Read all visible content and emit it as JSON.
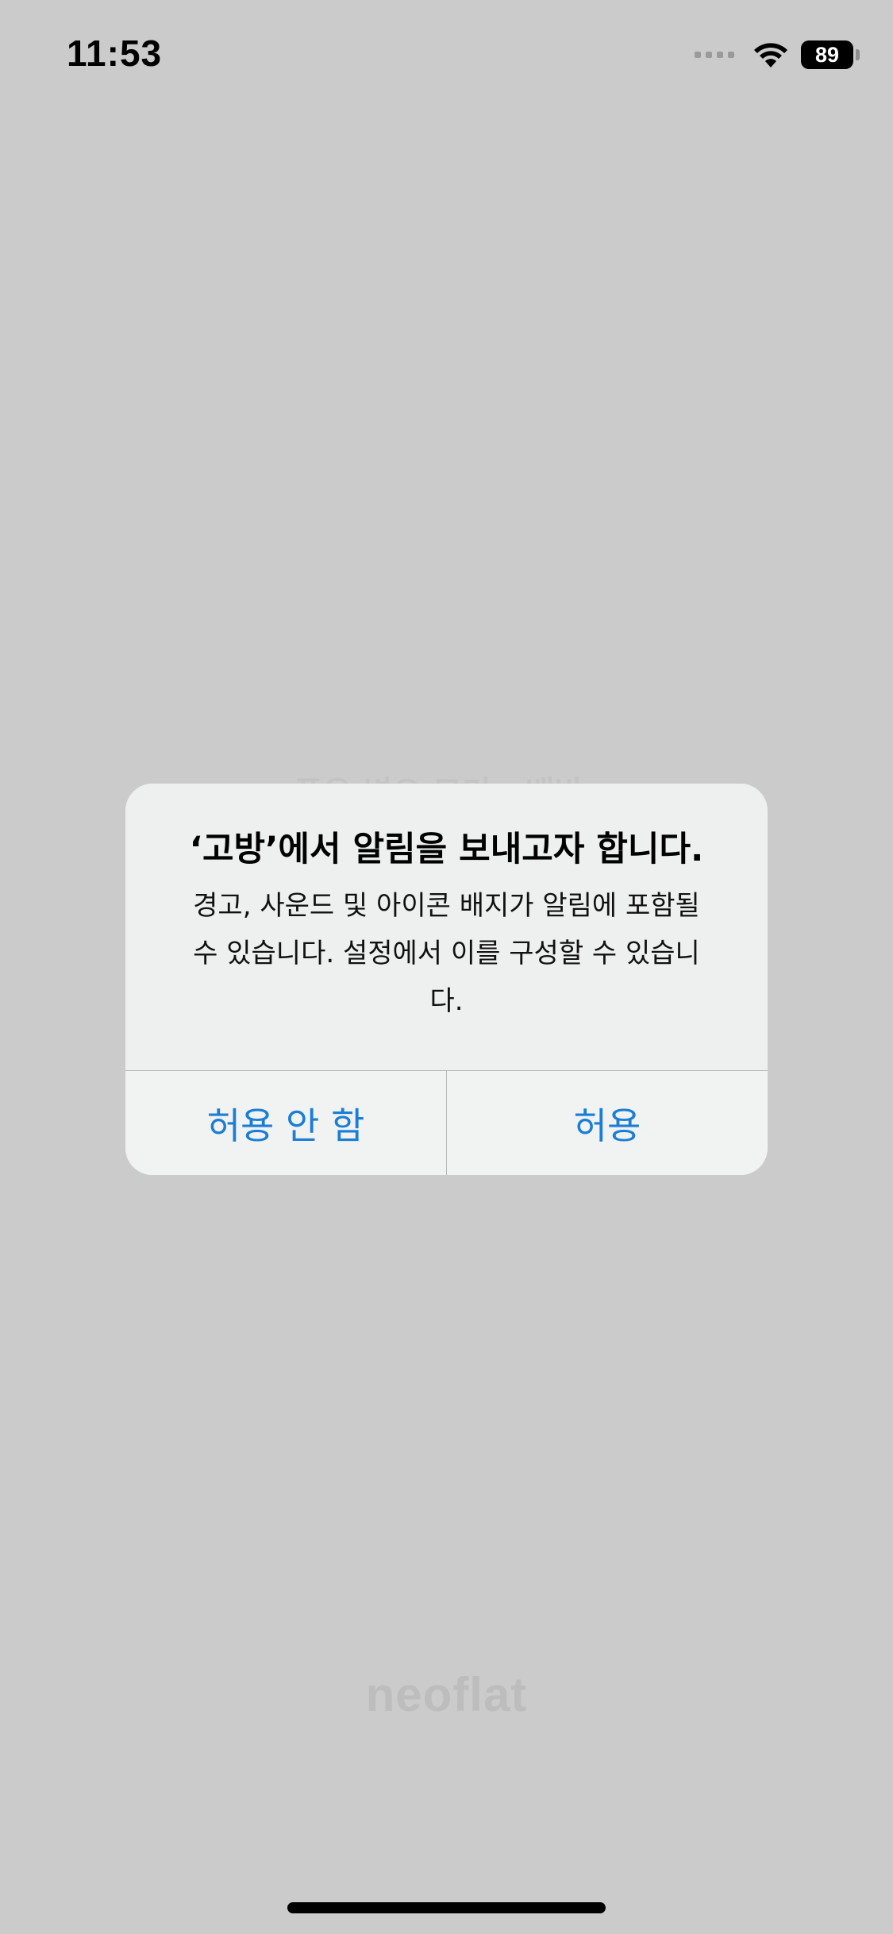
{
  "status_bar": {
    "time": "11:53",
    "battery_level": "89",
    "icons": [
      "signal-icon",
      "wifi-icon",
      "battery-icon"
    ]
  },
  "background": {
    "partial_title": "푸유 변으 모기 · 배바",
    "watermark": "neoflat"
  },
  "alert": {
    "title": "‘고방’에서 알림을 보내고자 합니다.",
    "message": "경고, 사운드 및 아이콘 배지가 알림에 포함될 수 있습니다. 설정에서 이를 구성할 수 있습니다.",
    "deny_label": "허용 안 함",
    "allow_label": "허용"
  },
  "colors": {
    "background": "#cbcbcb",
    "alert_background": "#eef0f0",
    "action_blue": "#1a7ed6"
  }
}
